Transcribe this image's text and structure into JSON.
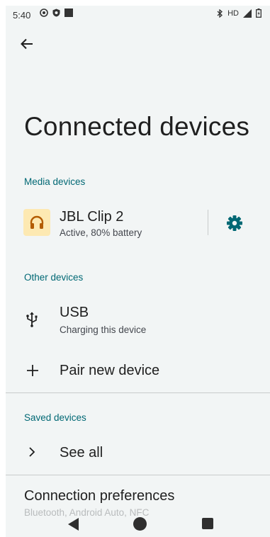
{
  "status_bar": {
    "time": "5:40",
    "network_label": "HD"
  },
  "header": {
    "title": "Connected devices"
  },
  "media_devices": {
    "header": "Media devices",
    "device": {
      "name": "JBL Clip 2",
      "status": "Active, 80% battery",
      "icon": "headphones-icon"
    }
  },
  "other_devices": {
    "header": "Other devices",
    "usb": {
      "title": "USB",
      "subtitle": "Charging this device"
    },
    "pair": {
      "label": "Pair new device"
    }
  },
  "saved_devices": {
    "header": "Saved devices",
    "see_all": {
      "label": "See all"
    }
  },
  "connection_preferences": {
    "title": "Connection preferences",
    "subtitle": "Bluetooth, Android Auto, NFC"
  },
  "colors": {
    "accent": "#006874",
    "icon_bg": "#fde9b2",
    "icon_fg": "#b35c00",
    "background": "#f2f5f5"
  }
}
